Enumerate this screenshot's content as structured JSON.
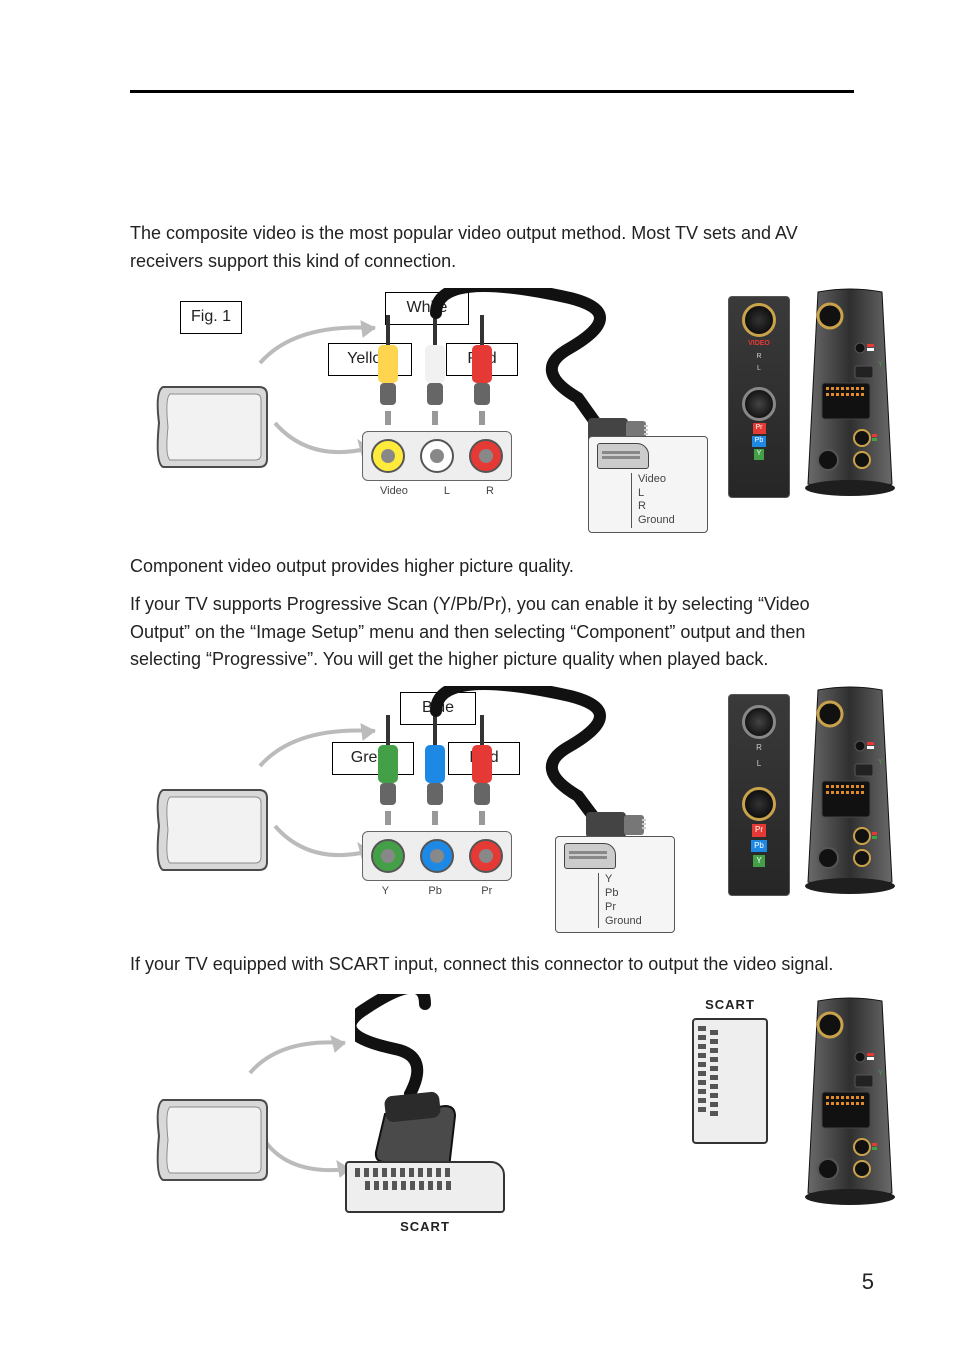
{
  "page_number": "5",
  "section1": {
    "para": "The composite video is the most popular video output method. Most TV sets and AV receivers support this kind of connection.",
    "figure_caption": "Fig. 1",
    "cable_colors": {
      "left": "Yellow",
      "mid": "White",
      "right": "Red"
    },
    "rca_labels": {
      "a": "Video",
      "b": "L",
      "c": "R"
    },
    "pinout": {
      "a": "Video",
      "b": "L",
      "c": "R",
      "d": "Ground"
    }
  },
  "section2": {
    "para1": "Component video output provides higher picture quality.",
    "para2": "If your TV supports Progressive Scan (Y/Pb/Pr), you can enable it by selecting “Video Output” on the “Image Setup” menu and then selecting “Component” output and then selecting “Progressive”. You will get the higher picture quality when played back.",
    "cable_colors": {
      "left": "Green",
      "mid": "Blue",
      "right": "Red"
    },
    "rca_labels": {
      "a": "Y",
      "b": "Pb",
      "c": "Pr"
    },
    "pinout": {
      "a": "Y",
      "b": "Pb",
      "c": "Pr",
      "d": "Ground"
    }
  },
  "section3": {
    "para": "If your TV equipped with SCART input, connect this connector to output the video signal.",
    "panel_label_top": "SCART",
    "panel_label_bottom": "SCART"
  },
  "device_port_labels": {
    "video": "VIDEO",
    "r": "R",
    "l": "L",
    "pr": "Pr",
    "pb": "Pb",
    "y": "Y"
  }
}
